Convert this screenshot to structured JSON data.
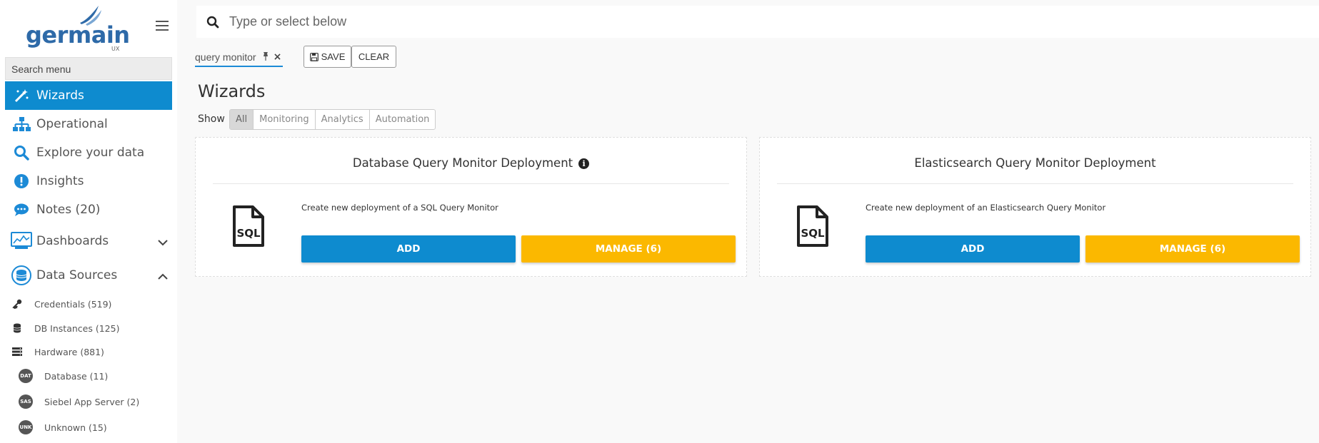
{
  "brand": {
    "name": "germain",
    "sub": "UX"
  },
  "sidebar": {
    "search_placeholder": "Search menu",
    "items": [
      {
        "label": "Wizards",
        "icon": "magic-wand-icon",
        "active": true
      },
      {
        "label": "Operational",
        "icon": "sitemap-icon"
      },
      {
        "label": "Explore your data",
        "icon": "search-icon"
      },
      {
        "label": "Insights",
        "icon": "exclamation-circle-icon"
      },
      {
        "label": "Notes (20)",
        "icon": "comment-icon"
      },
      {
        "label": "Dashboards",
        "icon": "monitor-dashboard-icon",
        "chevron": "down"
      },
      {
        "label": "Data Sources",
        "icon": "database-sources-icon",
        "chevron": "up"
      }
    ],
    "subitems": [
      {
        "label": "Credentials (519)",
        "icon": "key-icon"
      },
      {
        "label": "DB Instances (125)",
        "icon": "database-icon"
      },
      {
        "label": "Hardware (881)",
        "icon": "server-icon"
      }
    ],
    "subsubitems": [
      {
        "badge": "DAT",
        "label": "Database (11)"
      },
      {
        "badge": "SAS",
        "label": "Siebel App Server (2)"
      },
      {
        "badge": "UNK",
        "label": "Unknown (15)"
      }
    ]
  },
  "search": {
    "placeholder": "Type or select below"
  },
  "filter_chip": {
    "label": "query monitor"
  },
  "toolbar": {
    "save_label": "SAVE",
    "clear_label": "CLEAR"
  },
  "page": {
    "title": "Wizards",
    "show_label": "Show",
    "filters": [
      "All",
      "Monitoring",
      "Analytics",
      "Automation"
    ],
    "active_filter": "All"
  },
  "cards": [
    {
      "title": "Database Query Monitor Deployment",
      "has_info": true,
      "icon_text": "SQL",
      "description": "Create new deployment of a SQL Query Monitor",
      "add_label": "ADD",
      "manage_label": "MANAGE (6)"
    },
    {
      "title": "Elasticsearch Query Monitor Deployment",
      "has_info": false,
      "icon_text": "SQL",
      "description": "Create new deployment of an Elasticsearch Query Monitor",
      "add_label": "ADD",
      "manage_label": "MANAGE (6)"
    }
  ],
  "colors": {
    "primary": "#0e8bcf",
    "warning": "#fbb800",
    "brand": "#2e6aa8"
  }
}
